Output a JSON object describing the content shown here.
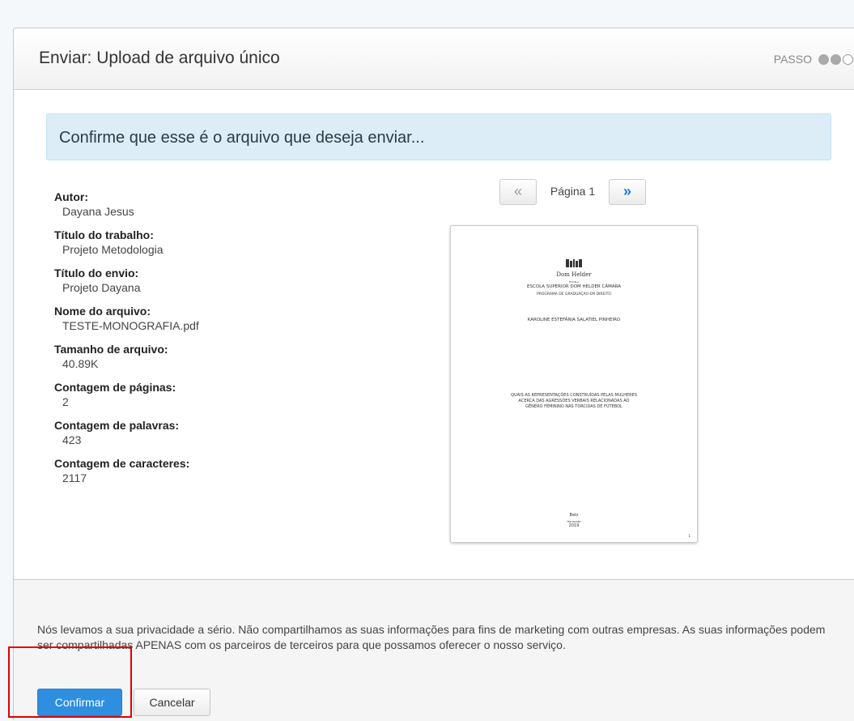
{
  "header": {
    "title": "Enviar: Upload de arquivo único",
    "step_label": "PASSO",
    "steps": [
      {
        "state": "filled"
      },
      {
        "state": "filled"
      },
      {
        "state": "empty"
      }
    ]
  },
  "alert": {
    "message": "Confirme que esse é o arquivo que deseja enviar..."
  },
  "fields": [
    {
      "label": "Autor:",
      "value": "Dayana Jesus"
    },
    {
      "label": "Título do trabalho:",
      "value": "Projeto Metodologia"
    },
    {
      "label": "Título do envio:",
      "value": "Projeto Dayana"
    },
    {
      "label": "Nome do arquivo:",
      "value": "TESTE-MONOGRAFIA.pdf"
    },
    {
      "label": "Tamanho de arquivo:",
      "value": "40.89K"
    },
    {
      "label": "Contagem de páginas:",
      "value": "2"
    },
    {
      "label": "Contagem de palavras:",
      "value": "423"
    },
    {
      "label": "Contagem de caracteres:",
      "value": "2117"
    }
  ],
  "pager": {
    "prev_label": "«",
    "page_label": "Página 1",
    "next_label": "»"
  },
  "preview": {
    "logo_text": "Dom Helder",
    "tiny_text": "ESCOLA",
    "school": "ESCOLA SUPERIOR DOM HELDER CÂMARA",
    "program": "PROGRAMA DE GRADUAÇÃO EM DIREITO",
    "author": "KAROLINE ESTEFÂNIA SALATIEL PINHEIRO",
    "title_line1": "QUAIS AS REPRESENTAÇÕES CONSTRUÍDAS PELAS MULHERES",
    "title_line2": "ACERCA DAS AGRESSÕES VERBAIS RELACIONADAS AO",
    "title_line3": "GÊNERO FEMININO NAS TORCIDAS DE FUTEBOL",
    "city1": "Belo",
    "city2": "Horizonte",
    "year": "2019",
    "page_number": "1"
  },
  "footer": {
    "privacy": "Nós levamos a sua privacidade a sério. Não compartilhamos as suas informações para fins de marketing com outras empresas. As suas informações podem ser compartilhadas APENAS com os parceiros de terceiros para que possamos oferecer o nosso serviço.",
    "confirm_label": "Confirmar",
    "cancel_label": "Cancelar"
  },
  "colors": {
    "primary": "#2e8fe0",
    "alert_bg": "#dcedf7",
    "highlight": "#e00000"
  }
}
